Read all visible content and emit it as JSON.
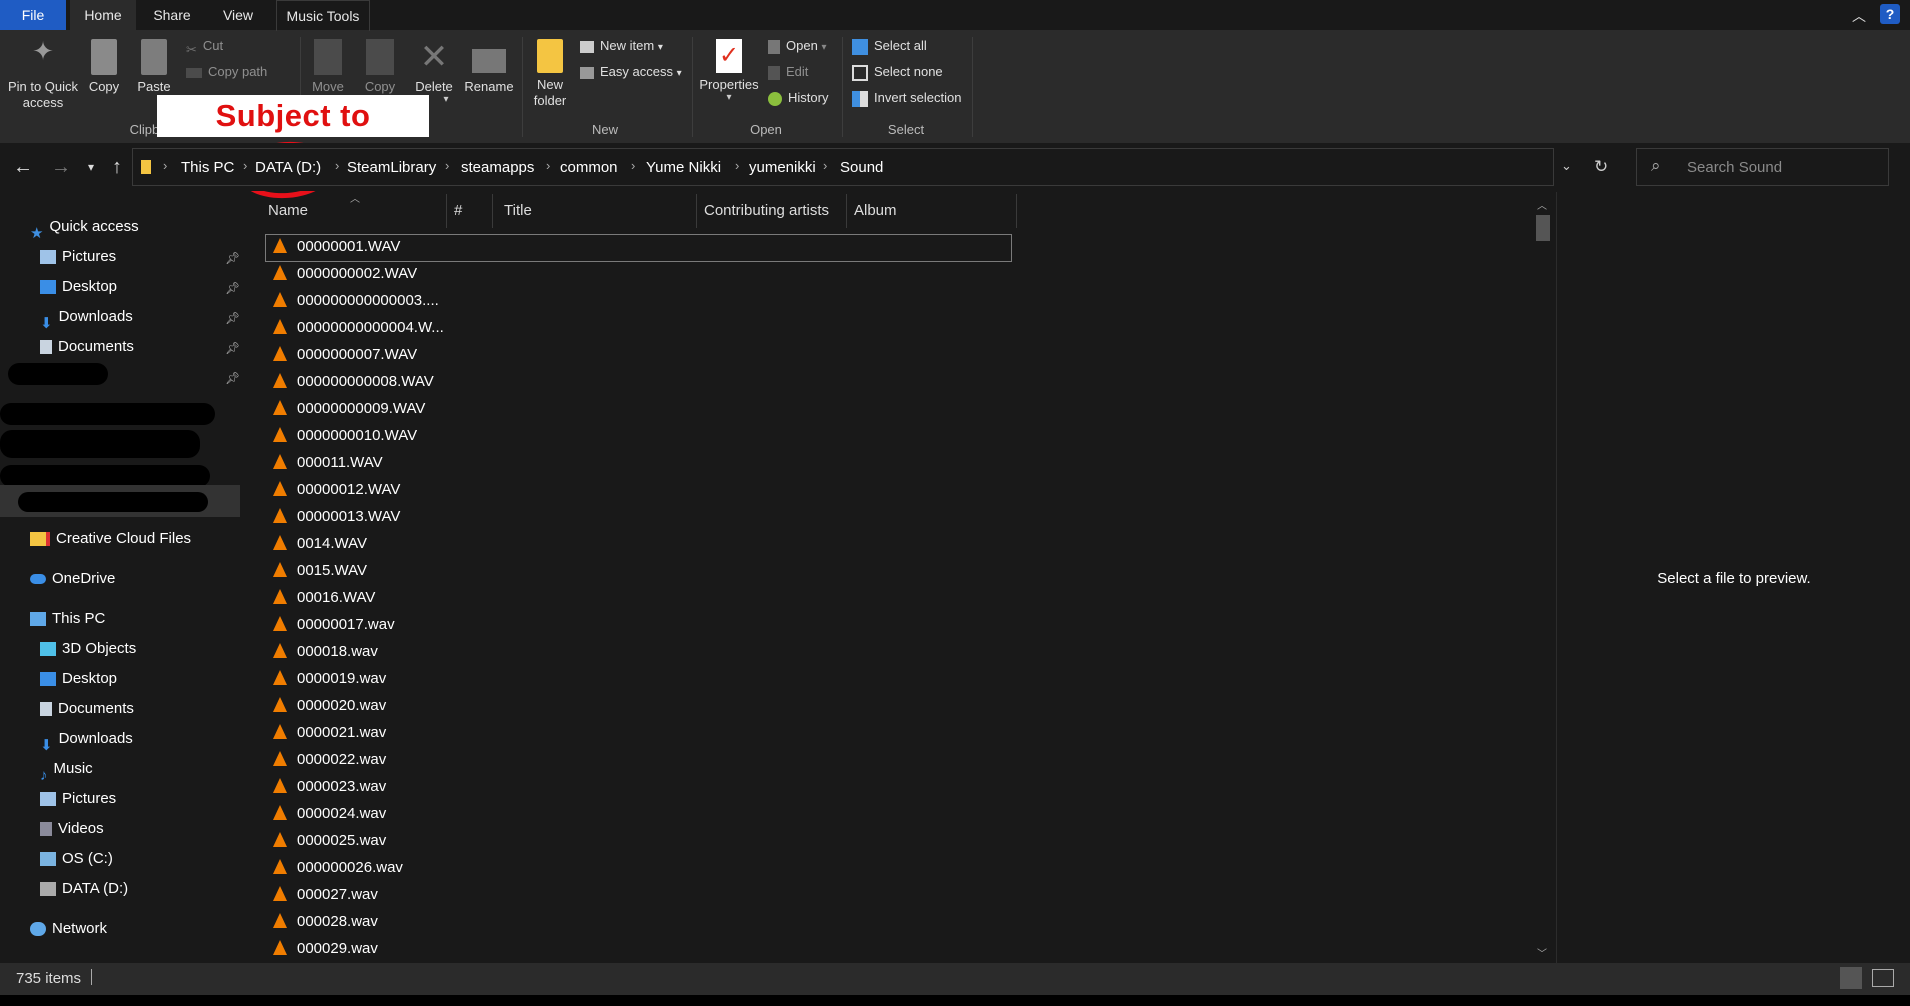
{
  "tabs": {
    "file": "File",
    "home": "Home",
    "share": "Share",
    "view": "View",
    "music_tools": "Music Tools"
  },
  "ribbon": {
    "pin": "Pin to Quick access",
    "copy": "Copy",
    "paste": "Paste",
    "cut": "Cut",
    "copy_path": "Copy path",
    "clipboard_group": "Clipbo",
    "move": "Move",
    "copy_to": "Copy",
    "delete": "Delete",
    "rename": "Rename",
    "new_folder": "New folder",
    "new_item": "New item",
    "easy_access": "Easy access",
    "new_group": "New",
    "properties": "Properties",
    "open": "Open",
    "edit": "Edit",
    "history": "History",
    "open_group": "Open",
    "select_all": "Select all",
    "select_none": "Select none",
    "invert_selection": "Invert selection",
    "select_group": "Select"
  },
  "annotation": "Subject to Change",
  "breadcrumbs": [
    "This PC",
    "DATA (D:)",
    "SteamLibrary",
    "steamapps",
    "common",
    "Yume Nikki",
    "yumenikki",
    "Sound"
  ],
  "search": {
    "placeholder": "Search Sound"
  },
  "nav": {
    "quick_access": "Quick access",
    "quick_items": [
      "Pictures",
      "Desktop",
      "Downloads",
      "Documents"
    ],
    "creative_cloud": "Creative Cloud Files",
    "onedrive": "OneDrive",
    "this_pc": "This PC",
    "pc_items": [
      "3D Objects",
      "Desktop",
      "Documents",
      "Downloads",
      "Music",
      "Pictures",
      "Videos",
      "OS (C:)",
      "DATA (D:)"
    ],
    "network": "Network"
  },
  "columns": {
    "name": "Name",
    "number": "#",
    "title": "Title",
    "artists": "Contributing artists",
    "album": "Album"
  },
  "files": [
    "00000001.WAV",
    "0000000002.WAV",
    "000000000000003....",
    "00000000000004.W...",
    "0000000007.WAV",
    "000000000008.WAV",
    "00000000009.WAV",
    "0000000010.WAV",
    "000011.WAV",
    "00000012.WAV",
    "00000013.WAV",
    "0014.WAV",
    "0015.WAV",
    "00016.WAV",
    "00000017.wav",
    "000018.wav",
    "0000019.wav",
    "0000020.wav",
    "0000021.wav",
    "0000022.wav",
    "0000023.wav",
    "0000024.wav",
    "0000025.wav",
    "000000026.wav",
    "000027.wav",
    "000028.wav",
    "000029.wav"
  ],
  "preview_text": "Select a file to preview.",
  "status": {
    "count": "735 items"
  },
  "colors": {
    "accent": "#1f5cc4",
    "annotation": "#e01010",
    "vlc_cone": "#f07d00"
  }
}
